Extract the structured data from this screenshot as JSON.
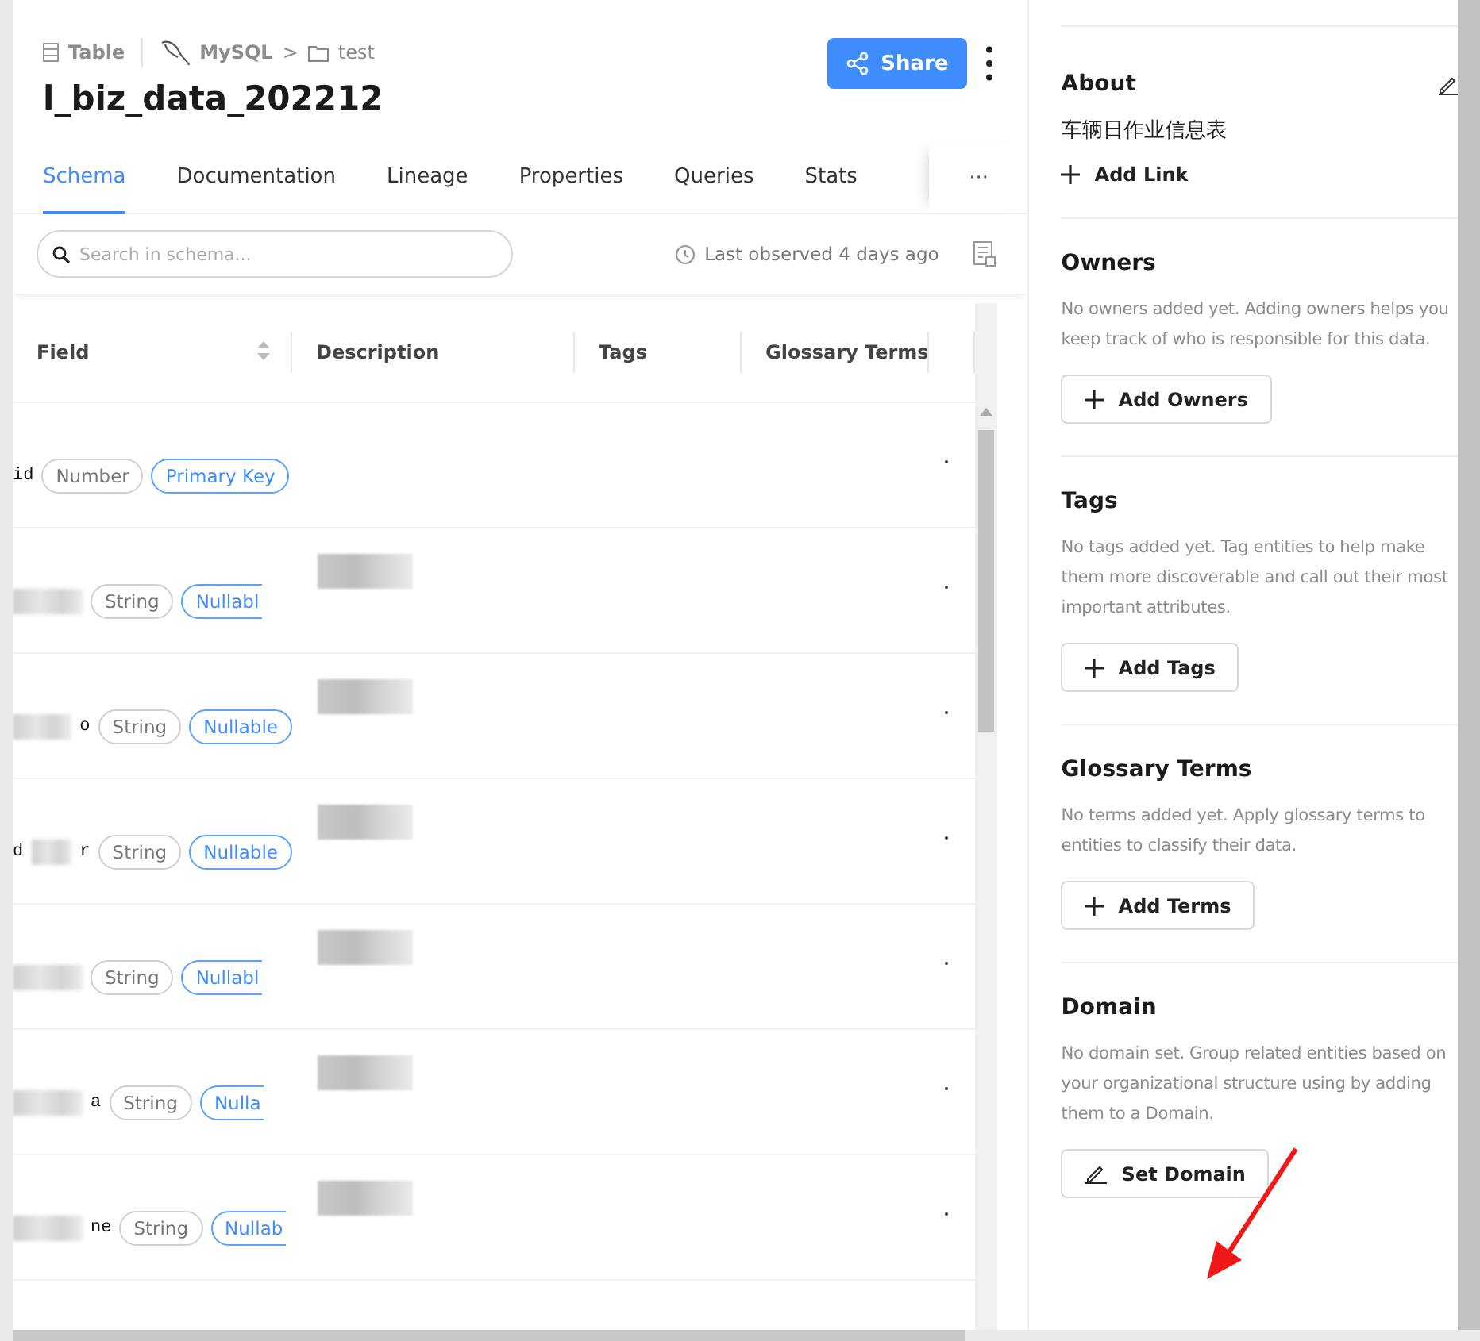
{
  "breadcrumb": {
    "type": "Table",
    "platform": "MySQL",
    "separator": ">",
    "container": "test"
  },
  "title": "l_biz_data_202212",
  "share_button": "Share",
  "tabs": [
    {
      "label": "Schema",
      "selected": true
    },
    {
      "label": "Documentation",
      "selected": false
    },
    {
      "label": "Lineage",
      "selected": false
    },
    {
      "label": "Properties",
      "selected": false
    },
    {
      "label": "Queries",
      "selected": false
    },
    {
      "label": "Stats",
      "selected": false
    }
  ],
  "more_tabs": "···",
  "search": {
    "placeholder": "Search in schema..."
  },
  "last_observed": "Last observed 4 days ago",
  "table": {
    "columns": [
      "Field",
      "Description",
      "Tags",
      "Glossary Terms"
    ],
    "rows": [
      {
        "name_suffix": "id",
        "name_redacted": false,
        "description_redacted": false,
        "pills": [
          {
            "label": "Number",
            "kind": "type",
            "clipped": false
          },
          {
            "label": "Primary Key",
            "kind": "key",
            "clipped": false
          }
        ]
      },
      {
        "name_redacted": true,
        "description_redacted": true,
        "pills": [
          {
            "label": "String",
            "kind": "type",
            "clipped": false
          },
          {
            "label": "Nullabl",
            "kind": "key",
            "clipped": true
          }
        ]
      },
      {
        "name_suffix": "o",
        "name_redacted": true,
        "description_redacted": true,
        "pills": [
          {
            "label": "String",
            "kind": "type",
            "clipped": false
          },
          {
            "label": "Nullable",
            "kind": "key",
            "clipped": false
          }
        ]
      },
      {
        "name_prefix": "d",
        "name_suffix": "r",
        "name_redacted": true,
        "description_redacted": true,
        "pills": [
          {
            "label": "String",
            "kind": "type",
            "clipped": false
          },
          {
            "label": "Nullable",
            "kind": "key",
            "clipped": false
          }
        ]
      },
      {
        "name_redacted": true,
        "description_redacted": true,
        "pills": [
          {
            "label": "String",
            "kind": "type",
            "clipped": false
          },
          {
            "label": "Nullabl",
            "kind": "key",
            "clipped": true
          }
        ]
      },
      {
        "name_suffix": "a",
        "name_redacted": true,
        "description_redacted": true,
        "pills": [
          {
            "label": "String",
            "kind": "type",
            "clipped": false
          },
          {
            "label": "Nulla",
            "kind": "key",
            "clipped": true
          }
        ]
      },
      {
        "name_suffix": "ne",
        "name_redacted": true,
        "description_redacted": true,
        "pills": [
          {
            "label": "String",
            "kind": "type",
            "clipped": false
          },
          {
            "label": "Nullab",
            "kind": "key",
            "clipped": true
          }
        ]
      }
    ]
  },
  "about": {
    "title": "About",
    "description": "车辆日作业信息表",
    "link_button": "Add Link"
  },
  "sections": [
    {
      "title": "Owners",
      "text": "No owners added yet. Adding owners helps you keep track of who is responsible for this data.",
      "button": "Add Owners",
      "kind": "add"
    },
    {
      "title": "Tags",
      "text": "No tags added yet. Tag entities to help make them more discoverable and call out their most important attributes.",
      "button": "Add Tags",
      "kind": "add"
    },
    {
      "title": "Glossary Terms",
      "text": "No terms added yet. Apply glossary terms to entities to classify their data.",
      "button": "Add Terms",
      "kind": "add"
    },
    {
      "title": "Domain",
      "text": "No domain set. Group related entities based on your organizational structure using by adding them to a Domain.",
      "button": "Set Domain",
      "kind": "set"
    }
  ]
}
